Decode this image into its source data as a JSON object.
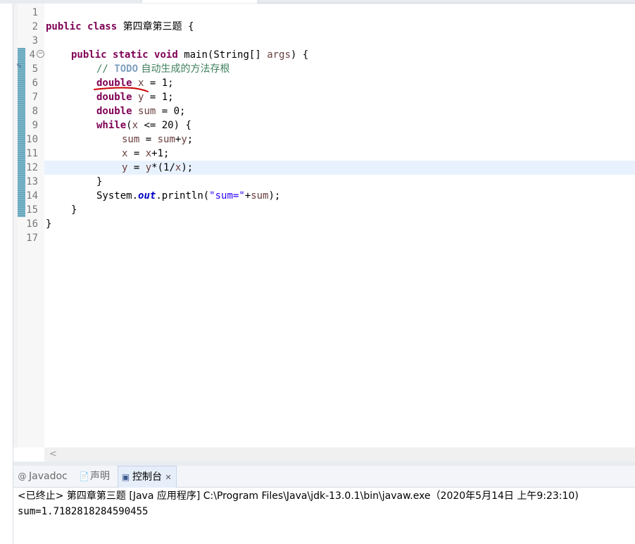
{
  "editor": {
    "line_numbers": [
      "1",
      "2",
      "3",
      "4",
      "5",
      "6",
      "7",
      "8",
      "9",
      "10",
      "11",
      "12",
      "13",
      "14",
      "15",
      "16",
      "17"
    ],
    "class_decl": {
      "kw_public": "public",
      "kw_class": "class",
      "class_name": "第四章第三题",
      "brace": "{"
    },
    "main_decl": {
      "kw_public": "public",
      "kw_static": "static",
      "kw_void": "void",
      "rest_a": "main(String[] ",
      "param": "args",
      "rest_b": ") {"
    },
    "todo_comment": {
      "prefix": "// ",
      "tag": "TODO",
      "text": " 自动生成的方法存根"
    },
    "line6": {
      "kw": "double",
      "var": "x",
      "rest": " = 1;"
    },
    "line7": {
      "kw": "double",
      "var": "y",
      "rest": " = 1;"
    },
    "line8": {
      "kw": "double",
      "var": "sum",
      "rest": " = 0;"
    },
    "line9": {
      "kw": "while",
      "a": "(",
      "var": "x",
      "b": " <= 20) {"
    },
    "line10": {
      "v1": "sum",
      "eq": " = ",
      "v2": "sum",
      "plus": "+",
      "v3": "y",
      "end": ";"
    },
    "line11": {
      "v1": "x",
      "eq": " = ",
      "v2": "x",
      "end": "+1;"
    },
    "line12": {
      "v1": "y",
      "eq": " = ",
      "v2": "y",
      "mid": "*(1/",
      "v3": "x",
      "end": ");"
    },
    "line13": "}",
    "line14": {
      "a": "System.",
      "field": "out",
      "b": ".println(",
      "str": "\"sum=\"",
      "c": "+",
      "var": "sum",
      "d": ");"
    },
    "line15": "}",
    "line16": "}"
  },
  "scrollbar": {
    "left_arrow": "<"
  },
  "views": {
    "tabs": [
      {
        "icon": "@",
        "label": "Javadoc"
      },
      {
        "icon": "📄",
        "label": "声明"
      },
      {
        "icon": "▣",
        "label": "控制台",
        "close": "✕"
      }
    ]
  },
  "console": {
    "header": "<已终止> 第四章第三题 [Java 应用程序] C:\\Program Files\\Java\\jdk-13.0.1\\bin\\javaw.exe（2020年5月14日 上午9:23:10)",
    "output": "sum=1.7182818284590455"
  },
  "colors": {
    "keyword": "#7f0055",
    "comment": "#3f7f5f",
    "local_var": "#6a3e3e",
    "string": "#2a00ff",
    "ink_annotation": "#cc0000",
    "current_line": "#e8f2fe"
  }
}
